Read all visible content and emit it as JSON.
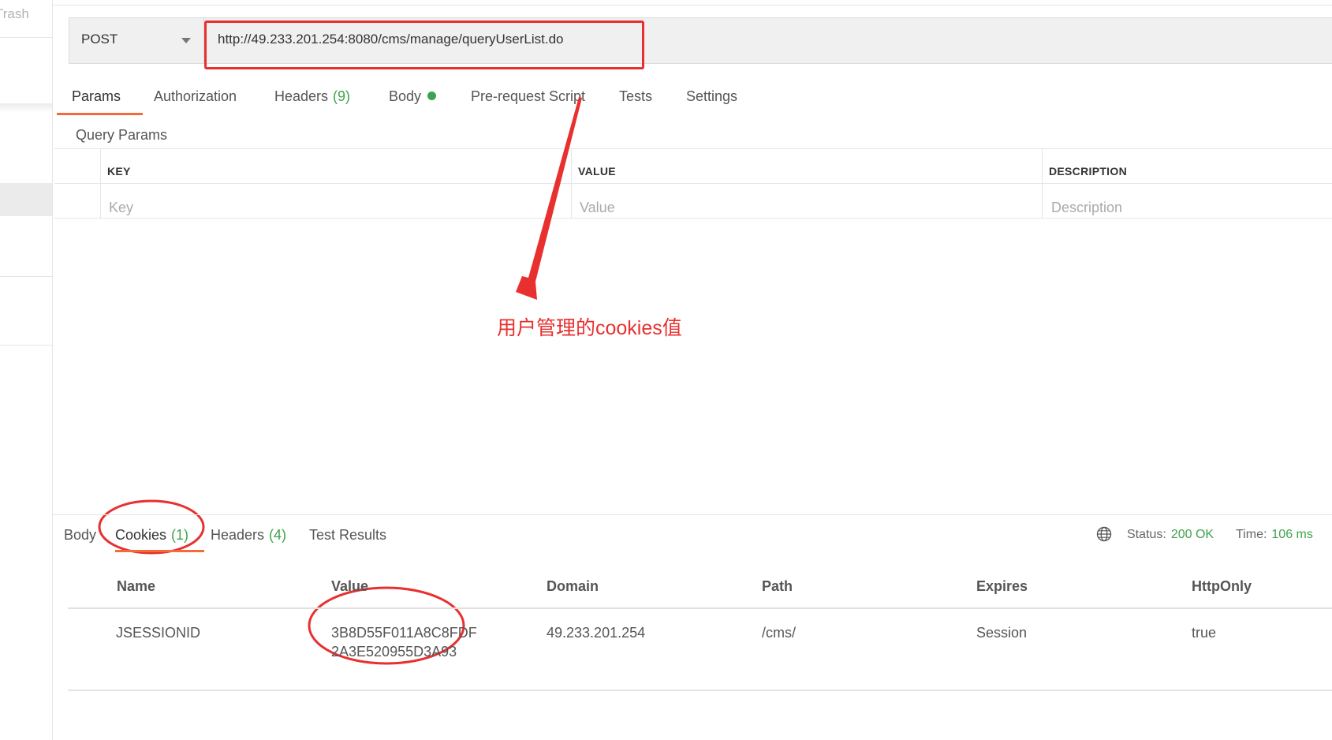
{
  "sidebar": {
    "trash_label": "Trash"
  },
  "request": {
    "method": "POST",
    "url": "http://49.233.201.254:8080/cms/manage/queryUserList.do"
  },
  "request_tabs": [
    {
      "label": "Params"
    },
    {
      "label": "Authorization"
    },
    {
      "label": "Headers",
      "count": "(9)"
    },
    {
      "label": "Body"
    },
    {
      "label": "Pre-request Script"
    },
    {
      "label": "Tests"
    },
    {
      "label": "Settings"
    }
  ],
  "params": {
    "title": "Query Params",
    "columns": [
      "KEY",
      "VALUE",
      "DESCRIPTION"
    ],
    "placeholders": [
      "Key",
      "Value",
      "Description"
    ]
  },
  "annotation": {
    "text": "用户管理的cookies值",
    "color": "#e8302f"
  },
  "response_tabs": [
    {
      "label": "Body"
    },
    {
      "label": "Cookies",
      "count": "(1)"
    },
    {
      "label": "Headers",
      "count": "(4)"
    },
    {
      "label": "Test Results"
    }
  ],
  "response_status": {
    "status_label": "Status:",
    "status_value": "200 OK",
    "time_label": "Time:",
    "time_value": "106 ms"
  },
  "cookies": {
    "columns": [
      "Name",
      "Value",
      "Domain",
      "Path",
      "Expires",
      "HttpOnly"
    ],
    "rows": [
      {
        "name": "JSESSIONID",
        "value": "3B8D55F011A8C8FDF2A3E520955D3A93",
        "domain": "49.233.201.254",
        "path": "/cms/",
        "expires": "Session",
        "httponly": "true"
      }
    ]
  },
  "colors": {
    "accent_orange": "#f26b3a",
    "green": "#3fa34d",
    "annotation_red": "#e8302f"
  },
  "icons": {
    "method_dropdown": "caret-down-icon",
    "network": "globe-icon"
  }
}
